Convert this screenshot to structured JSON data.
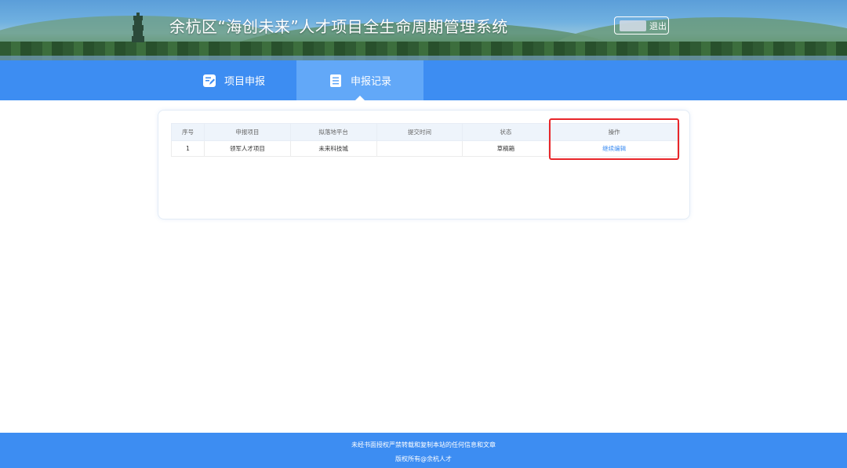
{
  "header": {
    "title": "余杭区“海创未来”人才项目全生命周期管理系统",
    "logout_label": "退出"
  },
  "nav": {
    "tabs": [
      {
        "label": "项目申报",
        "icon": "edit-doc-icon",
        "active": false
      },
      {
        "label": "申报记录",
        "icon": "list-doc-icon",
        "active": true
      }
    ]
  },
  "table": {
    "headers": [
      "序号",
      "申报项目",
      "拟落地平台",
      "提交时间",
      "状态",
      "操作"
    ],
    "rows": [
      {
        "index": "1",
        "project": "领军人才项目",
        "platform": "未来科技城",
        "submitted": "",
        "status": "草稿箱",
        "action": "继续编辑"
      }
    ]
  },
  "footer": {
    "line1": "未经书面授权严禁转载和复制本站的任何信息和文章",
    "line2": "版权所有@余杭人才"
  },
  "colors": {
    "primary": "#3d8df2",
    "active_tab": "#62a8f8",
    "highlight": "#e8262a"
  }
}
